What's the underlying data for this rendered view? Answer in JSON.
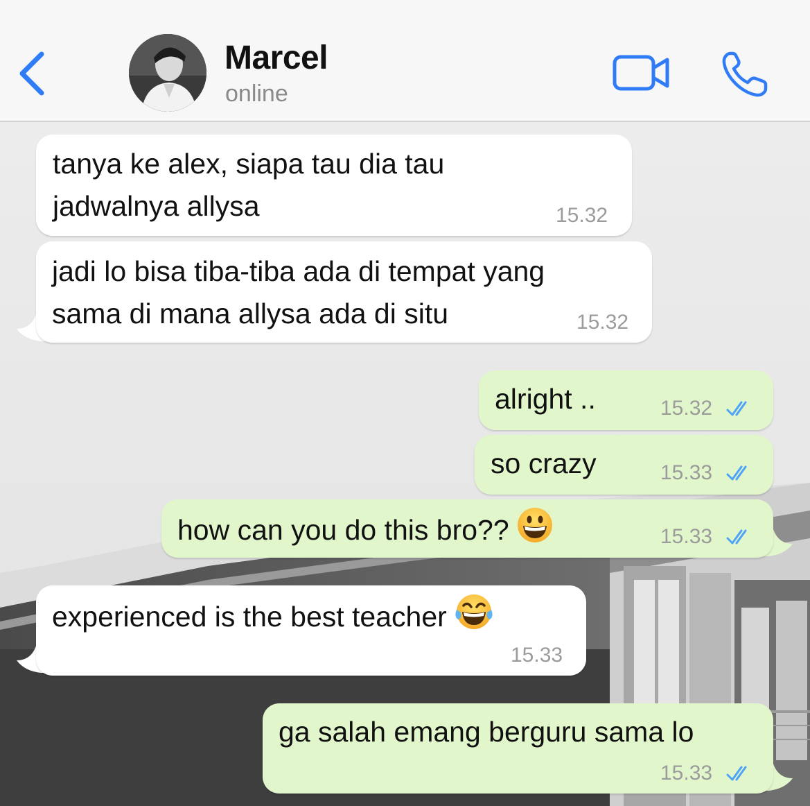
{
  "header": {
    "contact_name": "Marcel",
    "status": "online"
  },
  "colors": {
    "accent_blue": "#2f7cf6",
    "incoming_bubble": "#ffffff",
    "outgoing_bubble": "#e1f7cb",
    "read_tick": "#4fa3f7"
  },
  "messages": [
    {
      "direction": "in",
      "lines": [
        "tanya ke alex, siapa tau dia tau",
        "jadwalnya allysa"
      ],
      "time": "15.32"
    },
    {
      "direction": "in",
      "lines": [
        "jadi lo bisa tiba-tiba ada di tempat yang",
        "sama di mana allysa ada di situ"
      ],
      "time": "15.32"
    },
    {
      "direction": "out",
      "text": "alright ..",
      "time": "15.32",
      "status": "read"
    },
    {
      "direction": "out",
      "text": "so crazy",
      "time": "15.33",
      "status": "read"
    },
    {
      "direction": "out",
      "text": "how can you do this bro??",
      "emoji": "grinning-face",
      "time": "15.33",
      "status": "read"
    },
    {
      "direction": "in",
      "text": "experienced is the best teacher",
      "emoji": "face-with-tears-of-joy",
      "time": "15.33"
    },
    {
      "direction": "out",
      "text": "ga salah emang berguru sama lo",
      "time": "15.33",
      "status": "read"
    }
  ]
}
